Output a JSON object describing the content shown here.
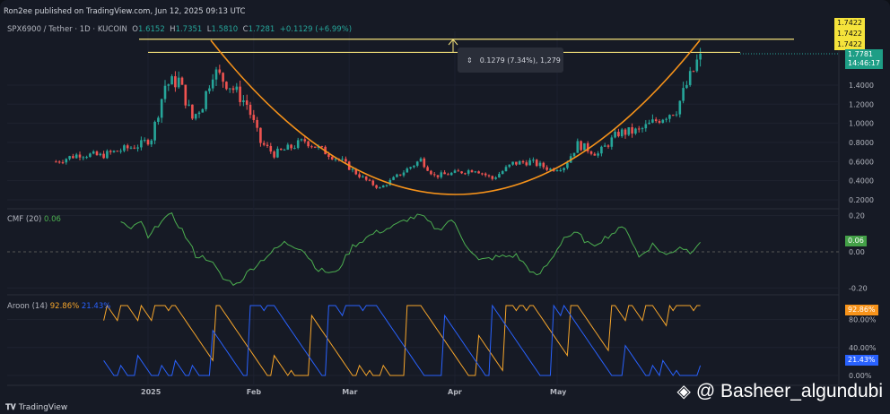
{
  "publish_line": "Ron2ee published on TradingView.com, Jun 12, 2025 09:13 UTC",
  "header": {
    "symbol": "SPX6900 / Tether · 1D · KUCOIN",
    "o_label": "O",
    "o": "1.6152",
    "h_label": "H",
    "h": "1.7351",
    "l_label": "L",
    "l": "1.5810",
    "c_label": "C",
    "c": "1.7281",
    "change": "+0.1129 (+6.99%)"
  },
  "price_labels": {
    "line1": "1.7422",
    "line2": "1.7422",
    "line3": "1.7422",
    "last_price": "1.7781",
    "countdown": "14:46:17"
  },
  "measure": {
    "text": "0.1279 (7.34%), 1,279"
  },
  "cmf": {
    "title": "CMF (20)",
    "value": "0.06",
    "axis": [
      "0.20",
      "0.00",
      "-0.20"
    ]
  },
  "aroon": {
    "title": "Aroon (14)",
    "up": "92.86%",
    "down": "21.43%",
    "axis": [
      "80.00%",
      "40.00%",
      "0.00%"
    ]
  },
  "watermark": "@ Basheer_algundubi",
  "branding": "TradingView",
  "colors": {
    "up": "#26a69a",
    "down": "#ef5350",
    "arc": "#f7931a",
    "level": "#f5e27a",
    "cmf": "#4caf50",
    "aroon_up": "#f7a62b",
    "aroon_down": "#2962ff"
  },
  "chart_data": {
    "type": "candlestick",
    "title": "SPX6900 / Tether · 1D · KUCOIN",
    "xlabel": "",
    "ylabel": "",
    "ylim": [
      0.15,
      1.95
    ],
    "y_ticks": [
      "1.4000",
      "1.2000",
      "1.0000",
      "0.8000",
      "0.6000",
      "0.4000",
      "0.2000"
    ],
    "x_ticks": [
      {
        "label": "2025",
        "day": 0
      },
      {
        "label": "Feb",
        "day": 31
      },
      {
        "label": "Mar",
        "day": 59
      },
      {
        "label": "Apr",
        "day": 90
      },
      {
        "label": "May",
        "day": 120
      }
    ],
    "day_range": [
      -27,
      162
    ],
    "close_keypoints": [
      [
        -27,
        0.6
      ],
      [
        -20,
        0.68
      ],
      [
        -14,
        0.66
      ],
      [
        -8,
        0.72
      ],
      [
        -2,
        0.78
      ],
      [
        1,
        0.85
      ],
      [
        5,
        1.4
      ],
      [
        9,
        1.45
      ],
      [
        13,
        1.05
      ],
      [
        16,
        1.2
      ],
      [
        19,
        1.55
      ],
      [
        24,
        1.4
      ],
      [
        29,
        1.2
      ],
      [
        33,
        0.8
      ],
      [
        37,
        0.68
      ],
      [
        42,
        0.75
      ],
      [
        46,
        0.82
      ],
      [
        52,
        0.7
      ],
      [
        57,
        0.6
      ],
      [
        61,
        0.48
      ],
      [
        65,
        0.38
      ],
      [
        68,
        0.32
      ],
      [
        72,
        0.42
      ],
      [
        76,
        0.52
      ],
      [
        80,
        0.62
      ],
      [
        84,
        0.45
      ],
      [
        90,
        0.48
      ],
      [
        96,
        0.52
      ],
      [
        101,
        0.42
      ],
      [
        107,
        0.58
      ],
      [
        112,
        0.6
      ],
      [
        118,
        0.52
      ],
      [
        122,
        0.55
      ],
      [
        126,
        0.78
      ],
      [
        132,
        0.68
      ],
      [
        138,
        0.9
      ],
      [
        144,
        0.92
      ],
      [
        150,
        1.05
      ],
      [
        155,
        1.15
      ],
      [
        158,
        1.4
      ],
      [
        160,
        1.55
      ],
      [
        162,
        1.73
      ]
    ],
    "levels": [
      {
        "price": 1.88,
        "label": ""
      },
      {
        "price": 1.7422,
        "label": "1.7422"
      }
    ],
    "cmf_keypoints": [
      [
        -8,
        0.17
      ],
      [
        -5,
        0.12
      ],
      [
        -2,
        0.17
      ],
      [
        0,
        0.07
      ],
      [
        4,
        0.18
      ],
      [
        7,
        0.2
      ],
      [
        10,
        0.12
      ],
      [
        14,
        -0.02
      ],
      [
        18,
        -0.04
      ],
      [
        22,
        -0.15
      ],
      [
        26,
        -0.18
      ],
      [
        30,
        -0.1
      ],
      [
        35,
        -0.02
      ],
      [
        40,
        0.05
      ],
      [
        45,
        0.02
      ],
      [
        50,
        -0.1
      ],
      [
        55,
        -0.12
      ],
      [
        60,
        0.03
      ],
      [
        66,
        0.1
      ],
      [
        72,
        0.14
      ],
      [
        76,
        0.18
      ],
      [
        80,
        0.2
      ],
      [
        85,
        0.12
      ],
      [
        89,
        0.18
      ],
      [
        93,
        0.05
      ],
      [
        97,
        -0.05
      ],
      [
        102,
        -0.03
      ],
      [
        108,
        -0.02
      ],
      [
        114,
        -0.14
      ],
      [
        118,
        -0.05
      ],
      [
        122,
        0.08
      ],
      [
        126,
        0.1
      ],
      [
        130,
        0.03
      ],
      [
        136,
        0.1
      ],
      [
        140,
        0.14
      ],
      [
        144,
        -0.03
      ],
      [
        148,
        0.04
      ],
      [
        152,
        -0.02
      ],
      [
        156,
        0.03
      ],
      [
        159,
        0.0
      ],
      [
        162,
        0.06
      ]
    ],
    "cmf_range": [
      -0.25,
      0.25
    ],
    "aroon_period": 14
  }
}
